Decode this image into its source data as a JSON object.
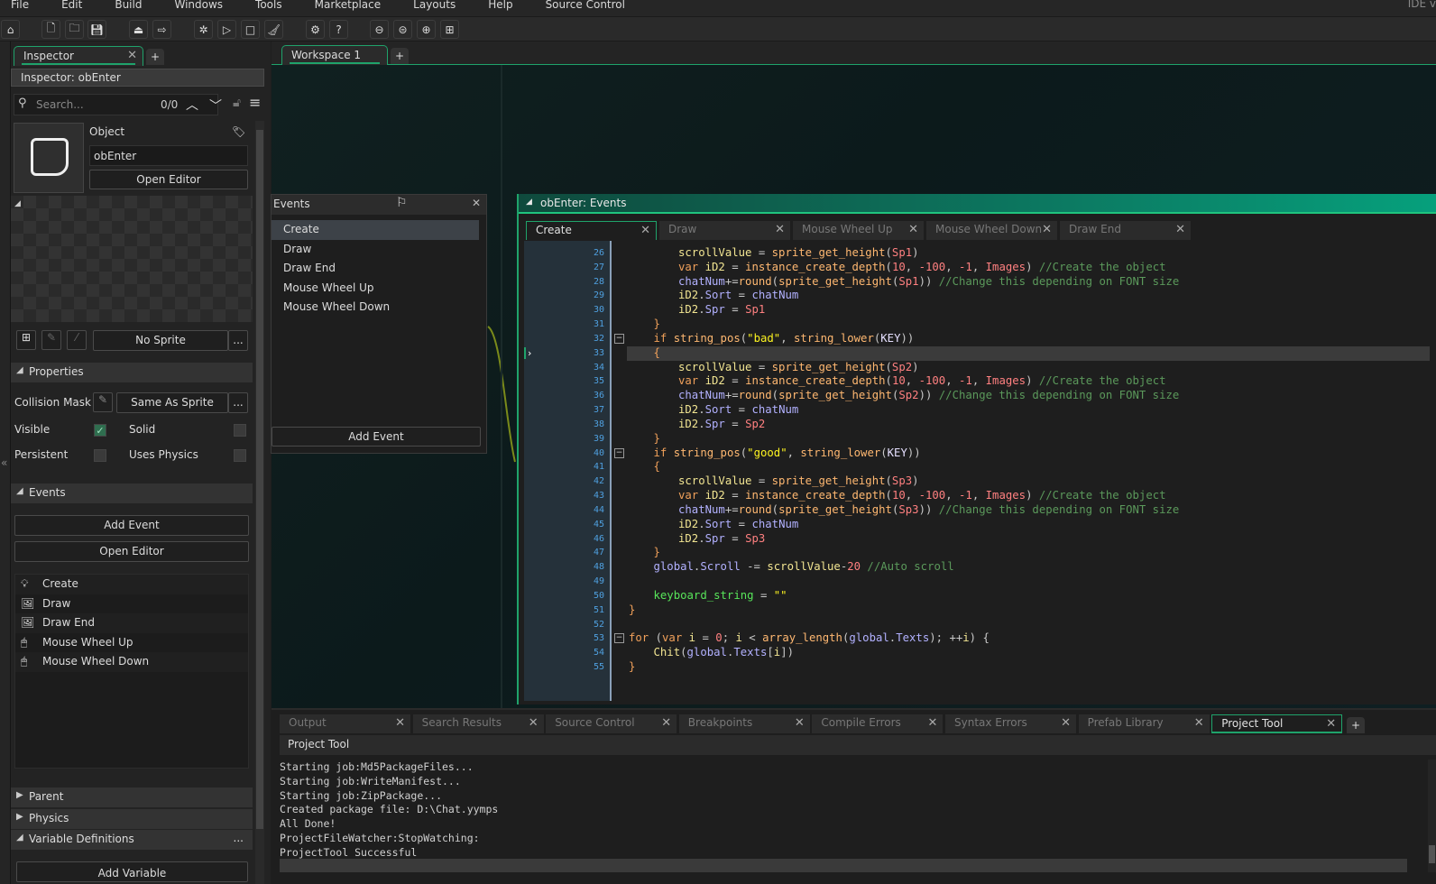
{
  "menu": [
    "File",
    "Edit",
    "Build",
    "Windows",
    "Tools",
    "Marketplace",
    "Layouts",
    "Help",
    "Source Control"
  ],
  "ide_label": "IDE v",
  "toolbar": [
    "home-icon",
    "new-project-icon",
    "open-project-icon",
    "save-icon",
    "create-executable-icon",
    "export-icon",
    "debug-icon",
    "run-icon",
    "stop-icon",
    "clean-icon",
    "preferences-icon",
    "help-icon",
    "zoom-out-icon",
    "zoom-reset-icon",
    "zoom-in-icon",
    "layout-icon"
  ],
  "inspector": {
    "tab": "Inspector",
    "title": "Inspector: obEnter",
    "search_placeholder": "Search...",
    "match_count": "0/0",
    "object_label": "Object",
    "object_name": "obEnter",
    "open_editor": "Open Editor",
    "sprite": "No Sprite",
    "more": "...",
    "properties_header": "Properties",
    "collision_mask_label": "Collision Mask",
    "collision_mask_value": "Same As Sprite",
    "visible": "Visible",
    "visible_checked": true,
    "solid": "Solid",
    "solid_checked": false,
    "persistent": "Persistent",
    "persistent_checked": false,
    "uses_physics": "Uses Physics",
    "uses_physics_checked": false,
    "events_header": "Events",
    "add_event": "Add Event",
    "open_editor2": "Open Editor",
    "events": [
      "Create",
      "Draw",
      "Draw End",
      "Mouse Wheel Up",
      "Mouse Wheel Down"
    ],
    "parent": "Parent",
    "physics": "Physics",
    "variable_definitions": "Variable Definitions",
    "add_variable": "Add Variable"
  },
  "workspace": {
    "tab": "Workspace 1"
  },
  "events_window": {
    "title": "Events",
    "items": [
      "Create",
      "Draw",
      "Draw End",
      "Mouse Wheel Up",
      "Mouse Wheel Down"
    ],
    "selected": 0,
    "add_event": "Add Event"
  },
  "code_window": {
    "title": "obEnter: Events",
    "tabs": [
      "Create",
      "Draw",
      "Mouse Wheel Up",
      "Mouse Wheel Down",
      "Draw End"
    ],
    "active_tab": 0,
    "first_line": 26,
    "current_line": 33,
    "fold_lines": [
      32,
      40,
      53
    ],
    "lines": [
      [
        2,
        [
          [
            "id",
            "scrollValue"
          ],
          [
            "op",
            " = "
          ],
          [
            "fn",
            "sprite_get_height"
          ],
          [
            "op",
            "("
          ],
          [
            "asset",
            "Sp1"
          ],
          [
            "op",
            ")"
          ]
        ]
      ],
      [
        2,
        [
          [
            "kw",
            "var "
          ],
          [
            "id",
            "iD2"
          ],
          [
            "op",
            " = "
          ],
          [
            "fn",
            "instance_create_depth"
          ],
          [
            "op",
            "("
          ],
          [
            "num",
            "10"
          ],
          [
            "op",
            ", "
          ],
          [
            "num",
            "-100"
          ],
          [
            "op",
            ", "
          ],
          [
            "num",
            "-1"
          ],
          [
            "op",
            ", "
          ],
          [
            "asset",
            "Images"
          ],
          [
            "op",
            ") "
          ],
          [
            "cm",
            "//Create the object"
          ]
        ]
      ],
      [
        2,
        [
          [
            "bi",
            "chatNum"
          ],
          [
            "op",
            "+="
          ],
          [
            "fn",
            "round"
          ],
          [
            "op",
            "("
          ],
          [
            "fn",
            "sprite_get_height"
          ],
          [
            "op",
            "("
          ],
          [
            "asset",
            "Sp1"
          ],
          [
            "op",
            "))"
          ],
          [
            "cm",
            " //Change this depending on FONT size"
          ]
        ]
      ],
      [
        2,
        [
          [
            "id",
            "iD2"
          ],
          [
            "op",
            "."
          ],
          [
            "bi",
            "Sort"
          ],
          [
            "op",
            " = "
          ],
          [
            "bi",
            "chatNum"
          ]
        ]
      ],
      [
        2,
        [
          [
            "id",
            "iD2"
          ],
          [
            "op",
            "."
          ],
          [
            "bi",
            "Spr"
          ],
          [
            "op",
            " = "
          ],
          [
            "asset",
            "Sp1"
          ]
        ]
      ],
      [
        1,
        [
          [
            "kw",
            "}"
          ]
        ]
      ],
      [
        1,
        [
          [
            "kw",
            "if "
          ],
          [
            "fn",
            "string_pos"
          ],
          [
            "op",
            "("
          ],
          [
            "str",
            "\"bad\""
          ],
          [
            "op",
            ", "
          ],
          [
            "fn",
            "string_lower"
          ],
          [
            "op",
            "("
          ],
          [
            "mac",
            "KEY"
          ],
          [
            "op",
            "))"
          ]
        ]
      ],
      [
        1,
        [
          [
            "kw",
            "{"
          ]
        ]
      ],
      [
        2,
        [
          [
            "id",
            "scrollValue"
          ],
          [
            "op",
            " = "
          ],
          [
            "fn",
            "sprite_get_height"
          ],
          [
            "op",
            "("
          ],
          [
            "asset",
            "Sp2"
          ],
          [
            "op",
            ")"
          ]
        ]
      ],
      [
        2,
        [
          [
            "kw",
            "var "
          ],
          [
            "id",
            "iD2"
          ],
          [
            "op",
            " = "
          ],
          [
            "fn",
            "instance_create_depth"
          ],
          [
            "op",
            "("
          ],
          [
            "num",
            "10"
          ],
          [
            "op",
            ", "
          ],
          [
            "num",
            "-100"
          ],
          [
            "op",
            ", "
          ],
          [
            "num",
            "-1"
          ],
          [
            "op",
            ", "
          ],
          [
            "asset",
            "Images"
          ],
          [
            "op",
            ") "
          ],
          [
            "cm",
            "//Create the object"
          ]
        ]
      ],
      [
        2,
        [
          [
            "bi",
            "chatNum"
          ],
          [
            "op",
            "+="
          ],
          [
            "fn",
            "round"
          ],
          [
            "op",
            "("
          ],
          [
            "fn",
            "sprite_get_height"
          ],
          [
            "op",
            "("
          ],
          [
            "asset",
            "Sp2"
          ],
          [
            "op",
            "))"
          ],
          [
            "cm",
            " //Change this depending on FONT size"
          ]
        ]
      ],
      [
        2,
        [
          [
            "id",
            "iD2"
          ],
          [
            "op",
            "."
          ],
          [
            "bi",
            "Sort"
          ],
          [
            "op",
            " = "
          ],
          [
            "bi",
            "chatNum"
          ]
        ]
      ],
      [
        2,
        [
          [
            "id",
            "iD2"
          ],
          [
            "op",
            "."
          ],
          [
            "bi",
            "Spr"
          ],
          [
            "op",
            " = "
          ],
          [
            "asset",
            "Sp2"
          ]
        ]
      ],
      [
        1,
        [
          [
            "kw",
            "}"
          ]
        ]
      ],
      [
        1,
        [
          [
            "kw",
            "if "
          ],
          [
            "fn",
            "string_pos"
          ],
          [
            "op",
            "("
          ],
          [
            "str",
            "\"good\""
          ],
          [
            "op",
            ", "
          ],
          [
            "fn",
            "string_lower"
          ],
          [
            "op",
            "("
          ],
          [
            "mac",
            "KEY"
          ],
          [
            "op",
            "))"
          ]
        ]
      ],
      [
        1,
        [
          [
            "kw",
            "{"
          ]
        ]
      ],
      [
        2,
        [
          [
            "id",
            "scrollValue"
          ],
          [
            "op",
            " = "
          ],
          [
            "fn",
            "sprite_get_height"
          ],
          [
            "op",
            "("
          ],
          [
            "asset",
            "Sp3"
          ],
          [
            "op",
            ")"
          ]
        ]
      ],
      [
        2,
        [
          [
            "kw",
            "var "
          ],
          [
            "id",
            "iD2"
          ],
          [
            "op",
            " = "
          ],
          [
            "fn",
            "instance_create_depth"
          ],
          [
            "op",
            "("
          ],
          [
            "num",
            "10"
          ],
          [
            "op",
            ", "
          ],
          [
            "num",
            "-100"
          ],
          [
            "op",
            ", "
          ],
          [
            "num",
            "-1"
          ],
          [
            "op",
            ", "
          ],
          [
            "asset",
            "Images"
          ],
          [
            "op",
            ") "
          ],
          [
            "cm",
            "//Create the object"
          ]
        ]
      ],
      [
        2,
        [
          [
            "bi",
            "chatNum"
          ],
          [
            "op",
            "+="
          ],
          [
            "fn",
            "round"
          ],
          [
            "op",
            "("
          ],
          [
            "fn",
            "sprite_get_height"
          ],
          [
            "op",
            "("
          ],
          [
            "asset",
            "Sp3"
          ],
          [
            "op",
            "))"
          ],
          [
            "cm",
            " //Change this depending on FONT size"
          ]
        ]
      ],
      [
        2,
        [
          [
            "id",
            "iD2"
          ],
          [
            "op",
            "."
          ],
          [
            "bi",
            "Sort"
          ],
          [
            "op",
            " = "
          ],
          [
            "bi",
            "chatNum"
          ]
        ]
      ],
      [
        2,
        [
          [
            "id",
            "iD2"
          ],
          [
            "op",
            "."
          ],
          [
            "bi",
            "Spr"
          ],
          [
            "op",
            " = "
          ],
          [
            "asset",
            "Sp3"
          ]
        ]
      ],
      [
        1,
        [
          [
            "kw",
            "}"
          ]
        ]
      ],
      [
        1,
        [
          [
            "bi",
            "global"
          ],
          [
            "op",
            "."
          ],
          [
            "bi",
            "Scroll"
          ],
          [
            "op",
            " -= "
          ],
          [
            "id",
            "scrollValue"
          ],
          [
            "op",
            "-"
          ],
          [
            "num",
            "20"
          ],
          [
            "cm",
            " //Auto scroll"
          ]
        ]
      ],
      [
        1,
        []
      ],
      [
        1,
        [
          [
            "gv",
            "keyboard_string"
          ],
          [
            "op",
            " = "
          ],
          [
            "str",
            "\"\""
          ]
        ]
      ],
      [
        0,
        [
          [
            "kw",
            "}"
          ]
        ]
      ],
      [
        0,
        []
      ],
      [
        0,
        [
          [
            "kw",
            "for "
          ],
          [
            "op",
            "("
          ],
          [
            "kw",
            "var "
          ],
          [
            "id",
            "i"
          ],
          [
            "op",
            " = "
          ],
          [
            "num",
            "0"
          ],
          [
            "op",
            "; "
          ],
          [
            "id",
            "i"
          ],
          [
            "op",
            " < "
          ],
          [
            "fn",
            "array_length"
          ],
          [
            "op",
            "("
          ],
          [
            "bi",
            "global"
          ],
          [
            "op",
            "."
          ],
          [
            "bi",
            "Texts"
          ],
          [
            "op",
            "); ++"
          ],
          [
            "id",
            "i"
          ],
          [
            "op",
            ") {"
          ]
        ]
      ],
      [
        1,
        [
          [
            "id",
            "Chit"
          ],
          [
            "op",
            "("
          ],
          [
            "bi",
            "global"
          ],
          [
            "op",
            "."
          ],
          [
            "bi",
            "Texts"
          ],
          [
            "op",
            "["
          ],
          [
            "id",
            "i"
          ],
          [
            "op",
            "])"
          ]
        ]
      ],
      [
        0,
        [
          [
            "kw",
            "}"
          ]
        ]
      ]
    ]
  },
  "bottom": {
    "tabs": [
      "Output",
      "Search Results",
      "Source Control",
      "Breakpoints",
      "Compile Errors",
      "Syntax Errors",
      "Prefab Library",
      "Project Tool"
    ],
    "active_tab": 7,
    "header": "Project Tool",
    "output": [
      "Starting job:Md5PackageFiles...",
      "Starting job:WriteManifest...",
      "Starting job:ZipPackage...",
      "Created package file: D:\\Chat.yymps",
      "All Done!",
      "ProjectFileWatcher:StopWatching:",
      "ProjectTool Successful"
    ]
  },
  "colors": {
    "accent": "#1fa36b",
    "line_numbers": "#4fa0e0",
    "comment": "#5b995b",
    "string": "#fcf320"
  }
}
